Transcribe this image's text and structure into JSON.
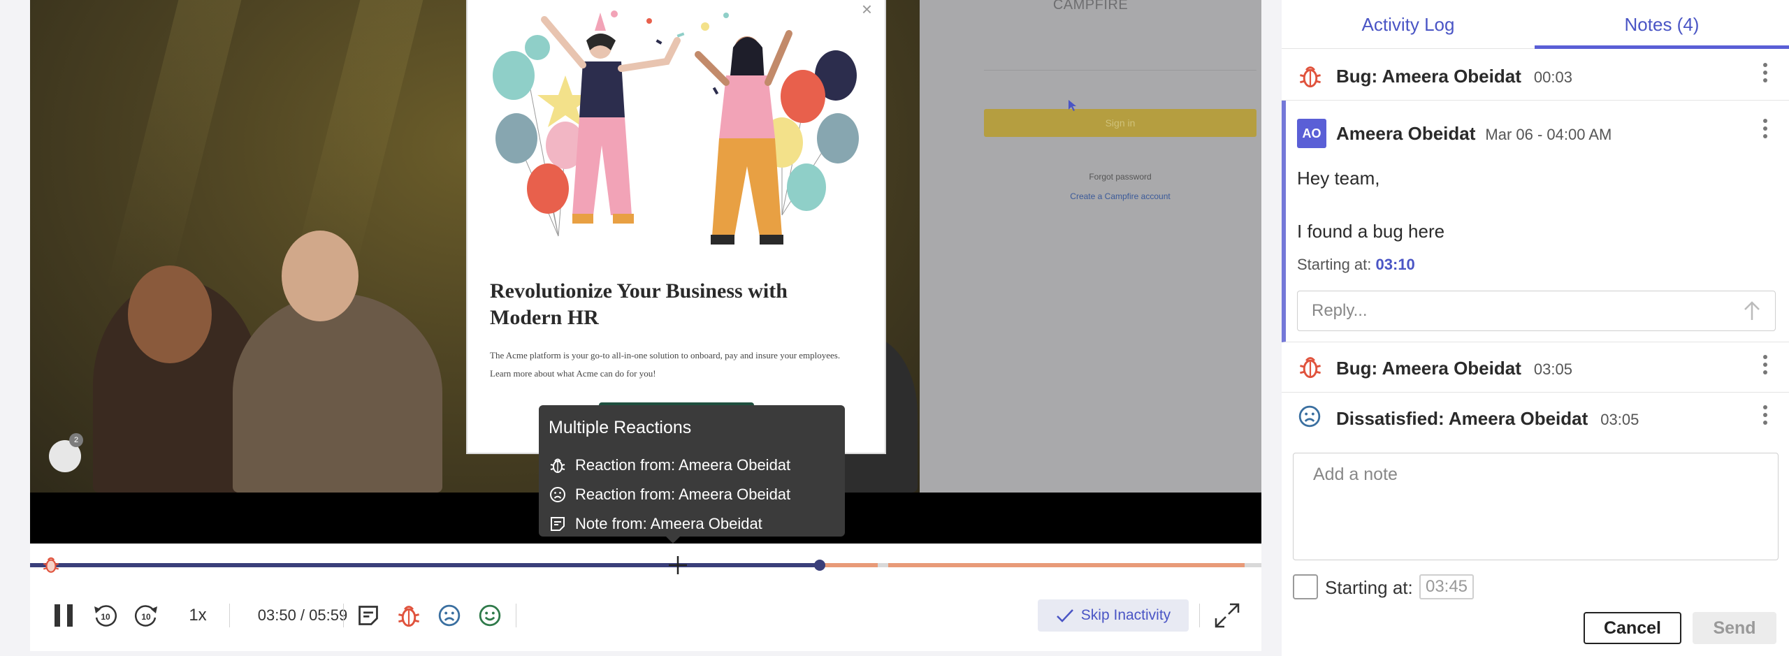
{
  "colors": {
    "accent": "#4a55c5",
    "accent_bar": "#5a5fd6",
    "bug_red": "#e0533d",
    "sad_blue": "#3a6fa0",
    "happy_green": "#2f7a4a",
    "played": "#3a3f7a",
    "inactive_orange": "#e89a78"
  },
  "video": {
    "webpage": {
      "brand": "CAMPFIRE",
      "signin_label": "Sign in",
      "forgot_label": "Forgot password",
      "create_label": "Create a Campfire account"
    },
    "popup": {
      "title": "Revolutionize Your Business with Modern HR",
      "description_line1": "The Acme platform is your go-to all-in-one solution to onboard, pay and insure your employees.",
      "description_line2": "Learn more about what Acme can do for you!",
      "close_symbol": "×"
    },
    "viewer_count": "2"
  },
  "tooltip": {
    "title": "Multiple Reactions",
    "rows": [
      {
        "icon": "bug-icon",
        "text": "Reaction from: Ameera Obeidat"
      },
      {
        "icon": "sad-face-icon",
        "text": "Reaction from: Ameera Obeidat"
      },
      {
        "icon": "note-icon",
        "text": "Note from: Ameera Obeidat"
      }
    ]
  },
  "timeline": {
    "progress": 0.64,
    "current": "03:50",
    "total": "05:59"
  },
  "controls": {
    "speed": "1x",
    "timecode": "03:50 / 05:59",
    "skip_inactivity": "Skip Inactivity",
    "icons": [
      "pause-icon",
      "rewind-10-icon",
      "forward-10-icon",
      "note-icon",
      "bug-icon",
      "sad-face-icon",
      "happy-face-icon",
      "check-icon",
      "fullscreen-icon"
    ]
  },
  "panel": {
    "tabs": [
      {
        "label": "Activity Log",
        "active": false
      },
      {
        "label": "Notes (4)",
        "active": true
      }
    ],
    "items": [
      {
        "type": "bug",
        "title": "Bug: Ameera Obeidat",
        "time": "00:03"
      },
      {
        "type": "bug",
        "title": "Bug: Ameera Obeidat",
        "time": "03:05"
      },
      {
        "type": "dissatisfied",
        "title": "Dissatisfied: Ameera Obeidat",
        "time": "03:05"
      }
    ],
    "note": {
      "initials": "AO",
      "author": "Ameera Obeidat",
      "date": "Mar 06 - 04:00 AM",
      "line1": "Hey team,",
      "line2": "I found a bug here",
      "starting_label": "Starting at:",
      "starting_time": "03:10",
      "reply_placeholder": "Reply..."
    },
    "composer": {
      "placeholder": "Add a note",
      "starting_label": "Starting at:",
      "starting_time": "03:45",
      "cancel_label": "Cancel",
      "send_label": "Send"
    }
  }
}
